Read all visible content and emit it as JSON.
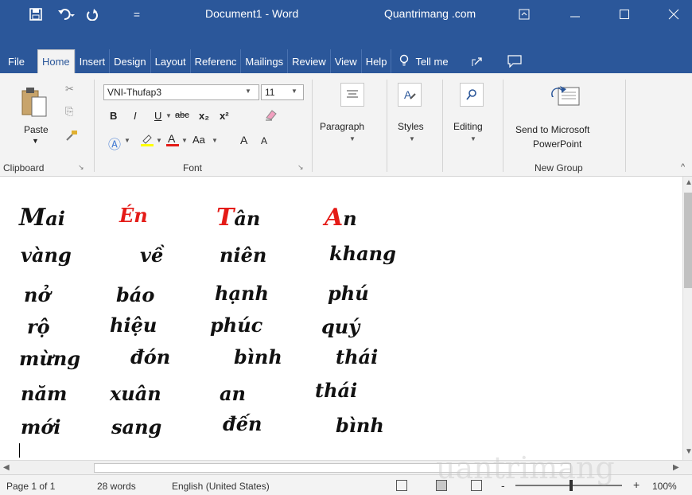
{
  "titlebar": {
    "doc_title": "Document1 - Word",
    "brand": "Quantrimang .com",
    "save_icon": "save-icon",
    "undo_icon": "undo-icon",
    "redo_icon": "redo-icon",
    "customize_icon": "customize-quick-access-icon"
  },
  "tabs": [
    "File",
    "Home",
    "Insert",
    "Design",
    "Layout",
    "Referenc",
    "Mailings",
    "Review",
    "View",
    "Help"
  ],
  "tell_me": "Tell me",
  "ribbon": {
    "clipboard": {
      "paste": "Paste",
      "label": "Clipboard"
    },
    "font": {
      "name": "VNI-Thufap3",
      "size": "11",
      "label": "Font",
      "bold": "B",
      "italic": "I",
      "underline": "U",
      "strike": "abc",
      "subscript": "x₂",
      "superscript": "x²",
      "case": "Aa",
      "grow": "A",
      "shrink": "A"
    },
    "paragraph": {
      "label": "Paragraph"
    },
    "styles": {
      "label": "Styles"
    },
    "editing": {
      "label": "Editing"
    },
    "newgroup": {
      "send_line1": "Send to Microsoft",
      "send_line2": "PowerPoint",
      "label": "New Group"
    }
  },
  "document": {
    "rows": [
      [
        "Mai",
        "Én",
        "Tân",
        "An"
      ],
      [
        "vàng",
        "về",
        "niên",
        "khang"
      ],
      [
        "nở",
        "báo",
        "hạnh",
        "phú"
      ],
      [
        "rộ",
        "hiệu",
        "phúc",
        "quý"
      ],
      [
        "mừng",
        "đón",
        "bình",
        "thái"
      ],
      [
        "năm",
        "xuân",
        "an",
        "thái"
      ],
      [
        "mới",
        "sang",
        "đến",
        "bình"
      ]
    ]
  },
  "status": {
    "page": "Page 1 of 1",
    "words": "28 words",
    "language": "English (United States)",
    "zoom": "100%",
    "minus": "-",
    "plus": "+"
  },
  "watermark": "uantrimang",
  "colors": {
    "accent": "#2b579a",
    "red": "#e41b17"
  }
}
